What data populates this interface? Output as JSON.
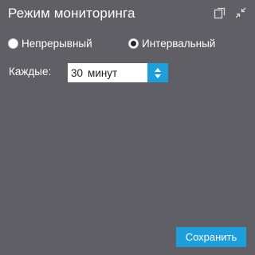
{
  "header": {
    "title": "Режим мониторинга",
    "icons": [
      "copy-icon",
      "collapse-icon"
    ]
  },
  "mode": {
    "options": [
      {
        "label": "Непрерывный",
        "selected": false
      },
      {
        "label": "Интервальный",
        "selected": true
      }
    ]
  },
  "interval": {
    "label": "Каждые:",
    "value": "30",
    "unit": "минут"
  },
  "footer": {
    "save_label": "Сохранить"
  },
  "colors": {
    "background": "#5f5f65",
    "accent": "#1e9fdc",
    "text": "#ffffff"
  }
}
